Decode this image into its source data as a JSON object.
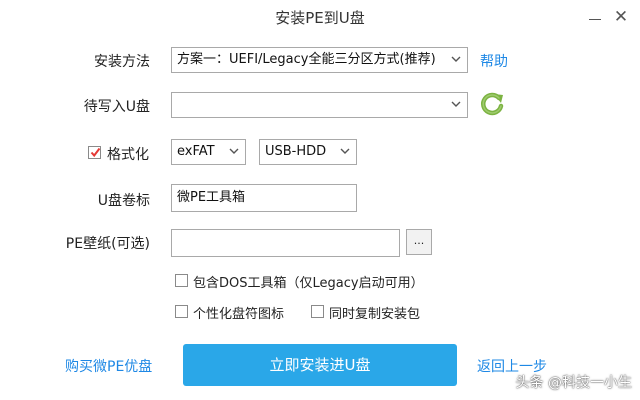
{
  "window": {
    "title": "安装PE到U盘",
    "minimize_glyph": "—",
    "close_glyph": "✕"
  },
  "install_method": {
    "label": "安装方法",
    "value": "方案一：UEFI/Legacy全能三分区方式(推荐)",
    "help_link": "帮助"
  },
  "target_drive": {
    "label": "待写入U盘",
    "value": ""
  },
  "format": {
    "label": "格式化",
    "checked": true,
    "filesystem": "exFAT",
    "mode": "USB-HDD"
  },
  "volume_label": {
    "label": "U盘卷标",
    "value": "微PE工具箱"
  },
  "wallpaper": {
    "label": "PE壁纸(可选)",
    "value": "",
    "browse_label": "..."
  },
  "options": {
    "include_dos": "包含DOS工具箱（仅Legacy启动可用）",
    "personalize_icon": "个性化盘符图标",
    "copy_package": "同时复制安装包"
  },
  "footer": {
    "buy_link": "购买微PE优盘",
    "install_button": "立即安装进U盘",
    "back_link": "返回上一步"
  },
  "watermark": "头条 @科技一小生",
  "colors": {
    "accent": "#2aa7e8",
    "link": "#1e88e5",
    "check": "#e53935",
    "refresh": "#7cb342"
  },
  "icons": {
    "refresh": "refresh-icon",
    "dropdown": "chevron-down-icon",
    "check": "check-icon"
  }
}
